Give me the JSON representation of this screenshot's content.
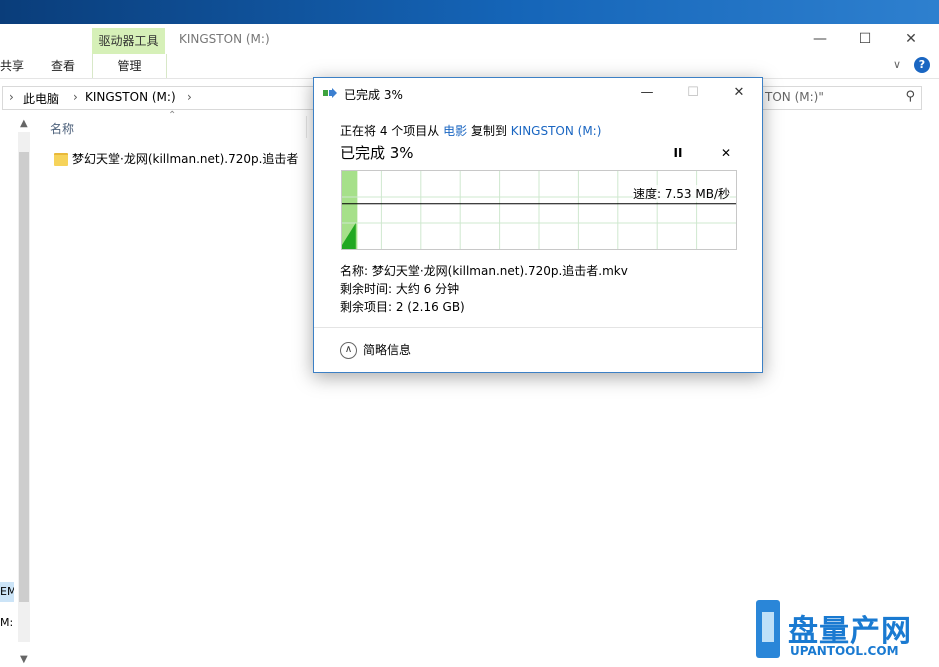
{
  "explorer": {
    "ribbon_context_header": "驱动器工具",
    "window_title": "KINGSTON (M:)",
    "tabs": [
      "共享",
      "查看",
      "管理"
    ],
    "breadcrumb": [
      "此电脑",
      "KINGSTON (M:)"
    ],
    "search_placeholder": "TON (M:)\"",
    "column_header": "名称",
    "files": [
      {
        "name": "梦幻天堂·龙网(killman.net).720p.追击者",
        "type": "folder"
      }
    ],
    "nav_labels": [
      "EM",
      "M:)"
    ]
  },
  "dialog": {
    "title": "已完成 3%",
    "copy_text_prefix": "正在将 4 个项目从",
    "source": "电影",
    "copy_text_mid": "复制到",
    "destination": "KINGSTON (M:)",
    "progress_title": "已完成 3%",
    "progress_percent": 3,
    "speed": "速度: 7.53 MB/秒",
    "name_line": "名称: 梦幻天堂·龙网(killman.net).720p.追击者.mkv",
    "time_remaining": "剩余时间: 大约 6 分钟",
    "items_remaining": "剩余项目: 2 (2.16 GB)",
    "details_toggle": "简略信息",
    "pause_label": "II",
    "cancel_label": "✕"
  },
  "watermark": {
    "big_text": "盘量产网",
    "small_text": "UPANTOOL.COM"
  },
  "colors": {
    "accent": "#1a66c2",
    "graph_fill": "#22a822",
    "graph_progress_bg": "#a6e08a",
    "context_tab": "#d6f0b8"
  }
}
